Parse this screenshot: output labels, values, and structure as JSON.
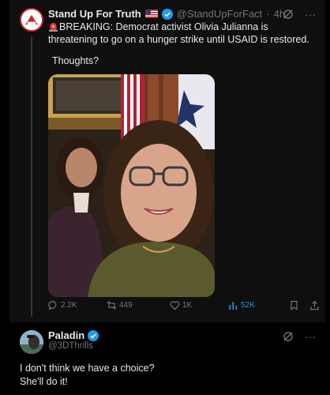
{
  "tweet": {
    "author_name": "Stand Up For Truth",
    "author_handle": "@StandUpForFact",
    "separator": "·",
    "time": "4h",
    "body_prefix_icon": "siren-icon",
    "body": "BREAKING: Democrat activist Olivia Julianna is threatening to go on a hunger strike until USAID is restored.",
    "subtext": "Thoughts?",
    "more_glyph": "···",
    "stats": {
      "replies": "2.2K",
      "reposts": "449",
      "likes": "1K",
      "views": "52K"
    }
  },
  "reply": {
    "author_name": "Paladin",
    "author_handle": "@3DThrills",
    "more_glyph": "···",
    "line1": "I don't think we have a choice?",
    "line2": "She'll do it!"
  },
  "colors": {
    "background": "#000000",
    "card": "#0f0f0f",
    "text": "#e7e9ea",
    "muted": "#71767b",
    "verified": "#1d9bf0"
  }
}
